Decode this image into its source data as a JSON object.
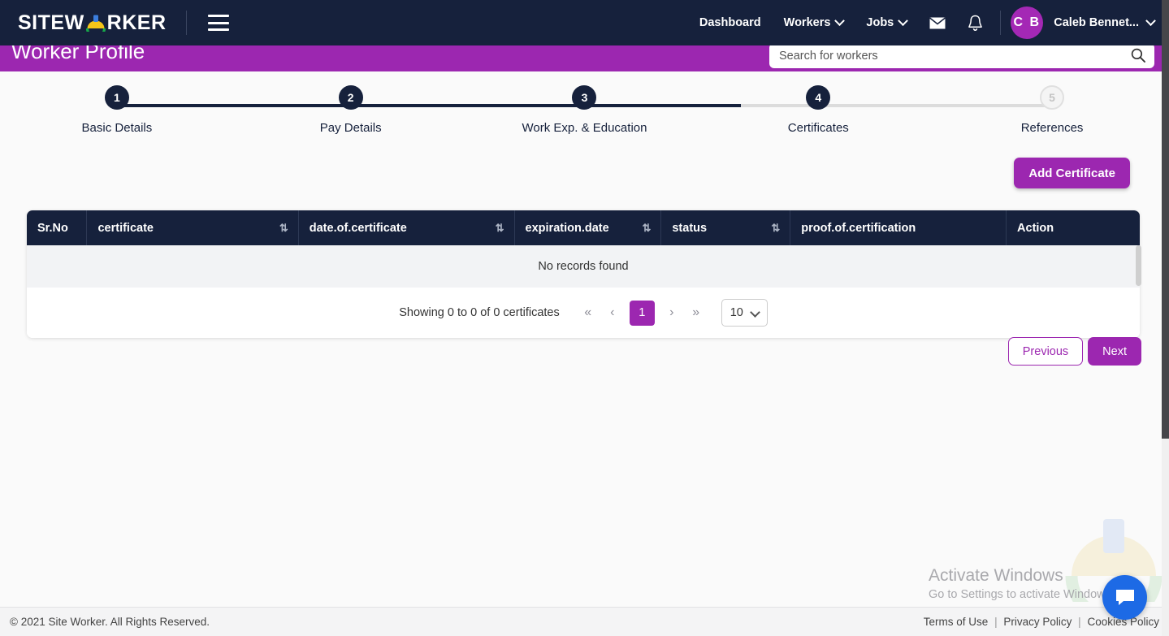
{
  "navbar": {
    "brand_prefix": "SITEW",
    "brand_suffix": "RKER",
    "menu_icon": "hamburger-icon",
    "links": [
      {
        "label": "Dashboard",
        "has_caret": false
      },
      {
        "label": "Workers",
        "has_caret": true
      },
      {
        "label": "Jobs",
        "has_caret": true
      }
    ],
    "mail_icon": "envelope-icon",
    "bell_icon": "bell-icon",
    "avatar_initials": "C B",
    "user_name": "Caleb Bennet...",
    "bg_color": "#16213c"
  },
  "subheader": {
    "title": "Worker Profile",
    "bg_color": "#9c27b0",
    "search": {
      "value": "",
      "placeholder": "Search for workers",
      "icon": "search-icon"
    }
  },
  "stepper": {
    "steps": [
      {
        "number": "1",
        "label": "Basic Details",
        "active": true
      },
      {
        "number": "2",
        "label": "Pay Details",
        "active": true
      },
      {
        "number": "3",
        "label": "Work Exp. & Education",
        "active": true
      },
      {
        "number": "4",
        "label": "Certificates",
        "active": true
      },
      {
        "number": "5",
        "label": "References",
        "active": false
      }
    ]
  },
  "actions": {
    "add_certificate": "Add Certificate",
    "previous": "Previous",
    "next": "Next"
  },
  "table": {
    "columns": [
      {
        "label": "Sr.No",
        "sortable": false
      },
      {
        "label": "certificate",
        "sortable": true
      },
      {
        "label": "date.of.certificate",
        "sortable": true
      },
      {
        "label": "expiration.date",
        "sortable": true
      },
      {
        "label": "status",
        "sortable": true
      },
      {
        "label": "proof.of.certification",
        "sortable": false
      },
      {
        "label": "Action",
        "sortable": false
      }
    ],
    "rows": [],
    "empty_message": "No records found",
    "sort_glyph": "⇅"
  },
  "pagination": {
    "summary": "Showing 0 to 0 of 0 certificates",
    "first_glyph": "«",
    "prev_glyph": "‹",
    "current_page": "1",
    "next_glyph": "›",
    "last_glyph": "»",
    "page_size": "10"
  },
  "watermark": {
    "title": "Activate Windows",
    "subtitle": "Go to Settings to activate Windows."
  },
  "chat": {
    "icon": "chat-bubble-icon",
    "color": "#1d6ae5"
  },
  "footer": {
    "copyright": "© 2021 Site Worker. All Rights Reserved.",
    "links": [
      {
        "label": "Terms of Use"
      },
      {
        "label": "Privacy Policy"
      },
      {
        "label": "Cookies Policy"
      }
    ],
    "separator": "|"
  },
  "theme": {
    "accent": "#9c27b0",
    "dark": "#16213c"
  }
}
